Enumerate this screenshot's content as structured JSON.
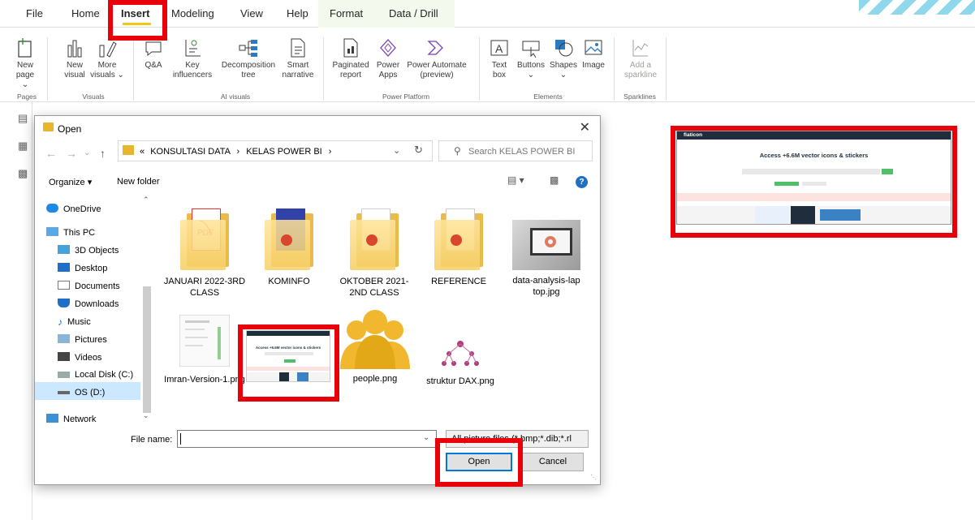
{
  "tabs": [
    "File",
    "Home",
    "Insert",
    "Modeling",
    "View",
    "Help",
    "Format",
    "Data / Drill"
  ],
  "active_tab": "Insert",
  "ribbon": {
    "buttons": [
      {
        "id": "new-page",
        "label1": "New",
        "label2": "page ⌄"
      },
      {
        "id": "new-visual",
        "label1": "New",
        "label2": "visual"
      },
      {
        "id": "more-visuals",
        "label1": "More",
        "label2": "visuals ⌄"
      },
      {
        "id": "qa",
        "label1": "Q&A",
        "label2": ""
      },
      {
        "id": "key-influencers",
        "label1": "Key",
        "label2": "influencers"
      },
      {
        "id": "decomposition-tree",
        "label1": "Decomposition",
        "label2": "tree"
      },
      {
        "id": "smart-narrative",
        "label1": "Smart",
        "label2": "narrative"
      },
      {
        "id": "paginated-report",
        "label1": "Paginated",
        "label2": "report"
      },
      {
        "id": "power-apps",
        "label1": "Power",
        "label2": "Apps"
      },
      {
        "id": "power-automate",
        "label1": "Power Automate",
        "label2": "(preview)"
      },
      {
        "id": "text-box",
        "label1": "Text",
        "label2": "box"
      },
      {
        "id": "buttons",
        "label1": "Buttons",
        "label2": "⌄"
      },
      {
        "id": "shapes",
        "label1": "Shapes",
        "label2": "⌄"
      },
      {
        "id": "image",
        "label1": "Image",
        "label2": ""
      },
      {
        "id": "add-sparkline",
        "label1": "Add a",
        "label2": "sparkline"
      }
    ],
    "groups": [
      "Pages",
      "Visuals",
      "AI visuals",
      "Power Platform",
      "Elements",
      "Sparklines"
    ]
  },
  "dialog": {
    "title": "Open",
    "address": {
      "prefix": "«",
      "crumbs": [
        "KONSULTASI DATA",
        "KELAS POWER BI"
      ]
    },
    "search_placeholder": "Search KELAS POWER BI",
    "toolbar": {
      "organize": "Organize ▾",
      "new_folder": "New folder"
    },
    "nav": [
      "OneDrive",
      "This PC",
      "3D Objects",
      "Desktop",
      "Documents",
      "Downloads",
      "Music",
      "Pictures",
      "Videos",
      "Local Disk (C:)",
      "OS (D:)",
      "Network"
    ],
    "nav_selected": "OS (D:)",
    "files": [
      {
        "name": "JANUARI 2022-3RD CLASS",
        "kind": "folder"
      },
      {
        "name": "KOMINFO",
        "kind": "folder"
      },
      {
        "name": "OKTOBER 2021-2ND CLASS",
        "kind": "folder"
      },
      {
        "name": "REFERENCE",
        "kind": "folder"
      },
      {
        "name": "data-analysis-laptop.jpg",
        "kind": "image"
      },
      {
        "name": "Imran-Version-1.png",
        "kind": "image"
      },
      {
        "name": "",
        "kind": "image"
      },
      {
        "name": "people.png",
        "kind": "image"
      },
      {
        "name": "struktur DAX.png",
        "kind": "image"
      }
    ],
    "file_name_label": "File name:",
    "file_name_value": "",
    "file_type": "All picture files (*.bmp;*.dib;*.rl",
    "open_label": "Open",
    "cancel_label": "Cancel"
  },
  "website_preview": {
    "brand": "flaticon",
    "headline": "Access +6.6M vector icons & stickers",
    "mini_headline": "Access +6.6M vector icons & stickers"
  },
  "colors": {
    "highlight": "#e8000b",
    "accent_yellow": "#f2c811",
    "selection": "#cce8ff"
  }
}
